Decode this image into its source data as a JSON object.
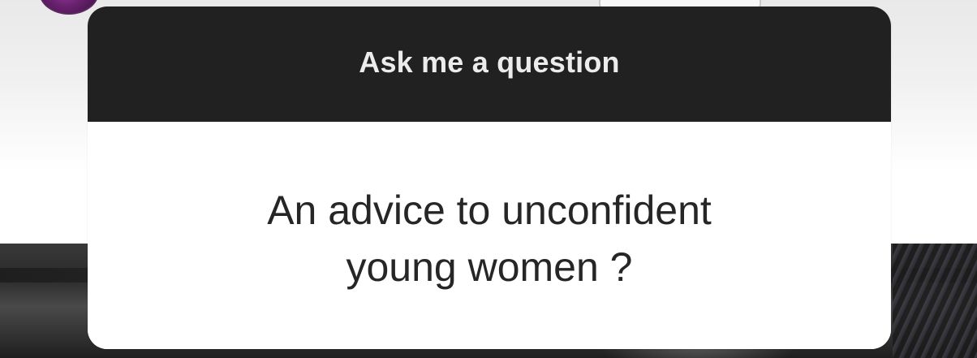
{
  "question_sticker": {
    "prompt": "Ask me a question",
    "question_lines": [
      "An advice to unconfident",
      "young women ?"
    ]
  },
  "colors": {
    "header_background": "#212121",
    "header_text": "#ececec",
    "card_background": "#ffffff",
    "question_text": "#262626"
  },
  "icons": {
    "profile_avatar": "avatar"
  }
}
